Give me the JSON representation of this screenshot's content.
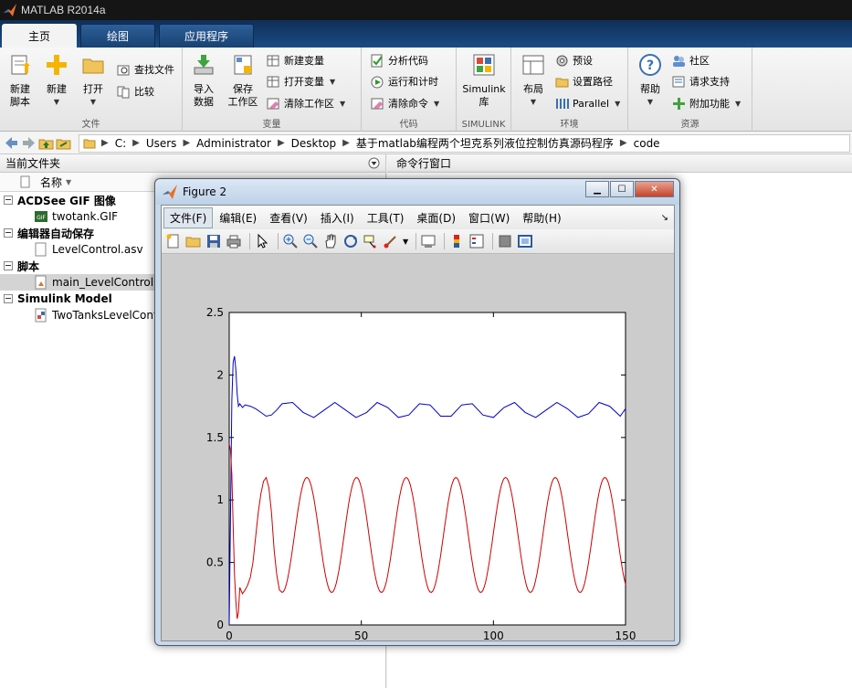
{
  "app": {
    "title": "MATLAB R2014a"
  },
  "tabs": [
    {
      "label": "主页"
    },
    {
      "label": "绘图"
    },
    {
      "label": "应用程序"
    }
  ],
  "ribbon": {
    "file": {
      "label": "文件",
      "new_script_l1": "新建",
      "new_script_l2": "脚本",
      "new": "新建",
      "open": "打开",
      "find_files": "查找文件",
      "compare": "比较"
    },
    "variable": {
      "label": "变量",
      "import_l1": "导入",
      "import_l2": "数据",
      "save_l1": "保存",
      "save_l2": "工作区",
      "new_variable": "新建变量",
      "open_variable": "打开变量",
      "clear_workspace": "清除工作区"
    },
    "code": {
      "label": "代码",
      "analyze": "分析代码",
      "run_time": "运行和计时",
      "clear_commands": "清除命令"
    },
    "simulink": {
      "label": "SIMULINK",
      "lib_l1": "Simulink",
      "lib_l2": "库"
    },
    "environment": {
      "label": "环境",
      "layout": "布局",
      "preferences": "预设",
      "set_path": "设置路径",
      "parallel": "Parallel"
    },
    "resources": {
      "label": "资源",
      "help": "帮助",
      "community": "社区",
      "support": "请求支持",
      "addons": "附加功能"
    }
  },
  "address": {
    "segments": [
      "C:",
      "Users",
      "Administrator",
      "Desktop",
      "基于matlab编程两个坦克系列液位控制仿真源码程序",
      "code"
    ]
  },
  "file_panel": {
    "title": "当前文件夹",
    "column_name": "名称",
    "groups": [
      {
        "name": "ACDSee GIF 图像",
        "items": [
          "twotank.GIF"
        ]
      },
      {
        "name": "编辑器自动保存",
        "items": [
          "LevelControl.asv"
        ]
      },
      {
        "name": "脚本",
        "items": [
          "main_LevelControl.m"
        ]
      },
      {
        "name": "Simulink Model",
        "items": [
          "TwoTanksLevelControl.slx"
        ]
      }
    ]
  },
  "command_panel": {
    "title": "命令行窗口"
  },
  "figure": {
    "title": "Figure 2",
    "menus": [
      "文件(F)",
      "编辑(E)",
      "查看(V)",
      "插入(I)",
      "工具(T)",
      "桌面(D)",
      "窗口(W)",
      "帮助(H)"
    ]
  },
  "chart_data": {
    "type": "line",
    "title": "",
    "xlabel": "",
    "ylabel": "",
    "xlim": [
      0,
      150
    ],
    "ylim": [
      0,
      2.5
    ],
    "xticks": [
      0,
      50,
      100,
      150
    ],
    "yticks": [
      0,
      0.5,
      1,
      1.5,
      2,
      2.5
    ],
    "grid": false,
    "series": [
      {
        "color": "#0000cc",
        "x": [
          0,
          1,
          1.5,
          2,
          2.5,
          3,
          3.5,
          4,
          5,
          6,
          8,
          10,
          12,
          14,
          16,
          18,
          20,
          24,
          28,
          32,
          36,
          40,
          44,
          48,
          52,
          56,
          60,
          64,
          68,
          72,
          76,
          80,
          84,
          88,
          92,
          96,
          100,
          104,
          108,
          112,
          116,
          120,
          124,
          128,
          132,
          136,
          140,
          144,
          148,
          150
        ],
        "y": [
          0,
          1.8,
          2.1,
          2.15,
          2.05,
          1.85,
          1.75,
          1.77,
          1.74,
          1.76,
          1.75,
          1.73,
          1.7,
          1.67,
          1.68,
          1.72,
          1.77,
          1.78,
          1.7,
          1.66,
          1.72,
          1.78,
          1.72,
          1.66,
          1.7,
          1.78,
          1.74,
          1.66,
          1.68,
          1.77,
          1.76,
          1.67,
          1.67,
          1.76,
          1.77,
          1.68,
          1.66,
          1.74,
          1.78,
          1.7,
          1.66,
          1.72,
          1.78,
          1.73,
          1.66,
          1.69,
          1.78,
          1.75,
          1.67,
          1.73
        ]
      },
      {
        "color": "#cc0000",
        "x": [
          0,
          0.5,
          1,
          1.5,
          2,
          2.5,
          3,
          3.5,
          4,
          5,
          6,
          7,
          8,
          9,
          10,
          11,
          12,
          13,
          14,
          15,
          16,
          17,
          18,
          19,
          20
        ],
        "y": [
          1.45,
          1.4,
          1.2,
          0.8,
          0.4,
          0.2,
          0.05,
          0.1,
          0.3,
          0.25,
          0.28,
          0.32,
          0.38,
          0.5,
          0.7,
          0.9,
          1.05,
          1.15,
          1.18,
          1.1,
          0.9,
          0.6,
          0.4,
          0.28,
          0.26
        ],
        "periodic": {
          "from": 20,
          "to": 150,
          "period": 18.8,
          "min": 0.26,
          "max": 1.18,
          "phase_at_from": 0.26
        }
      }
    ]
  }
}
